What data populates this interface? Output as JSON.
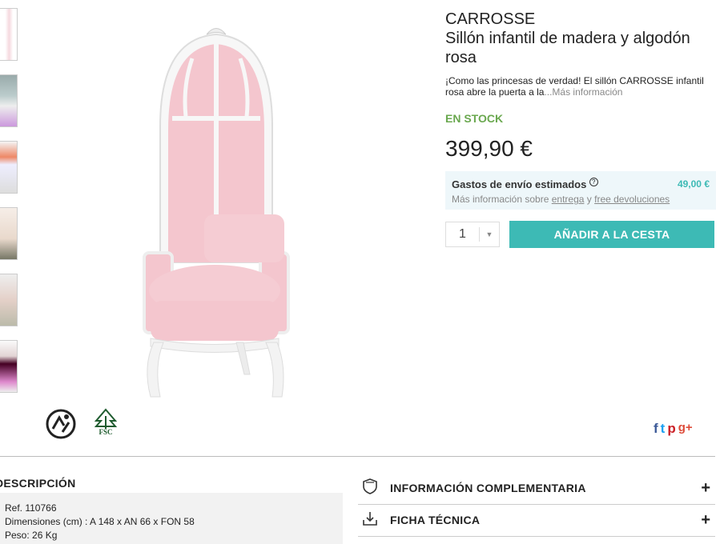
{
  "product": {
    "brand": "CARROSSE",
    "title": "Sillón infantil de madera y algodón rosa",
    "description_text": "¡Como las princesas de verdad! El sillón CARROSSE infantil rosa abre la puerta a la",
    "description_more": "...Más información",
    "stock_status": "EN STOCK",
    "price": "399,90 €"
  },
  "shipping": {
    "label": "Gastos de envío estimados",
    "help_icon": "?",
    "cost": "49,00 €",
    "info_prefix": "Más información sobre",
    "delivery_link": "entrega",
    "connector": "y",
    "returns_link": "free devoluciones"
  },
  "purchase": {
    "quantity": "1",
    "quantity_arrow": "▼",
    "add_to_cart_label": "AÑADIR A LA CESTA"
  },
  "eco": {
    "recycle_icon": "recycle-icon",
    "fsc_label": "FSC"
  },
  "social": {
    "facebook": "f",
    "twitter": "t",
    "pinterest": "p",
    "googleplus": "g+"
  },
  "description_section": {
    "heading": "DESCRIPCIÓN",
    "ref": "Ref. 110766",
    "dimensions": "Dimensiones (cm) : A 148 x AN 66 x FON 58",
    "weight": "Peso: 26 Kg"
  },
  "accordions": [
    {
      "label": "INFORMACIÓN COMPLEMENTARIA",
      "icon": "shield-icon",
      "toggle": "+"
    },
    {
      "label": "FICHA TÉCNICA",
      "icon": "download-tray-icon",
      "toggle": "+"
    }
  ],
  "colors": {
    "accent": "#3dbab5",
    "stock": "#6aa84f",
    "chair_pink": "#f4c6ce"
  }
}
